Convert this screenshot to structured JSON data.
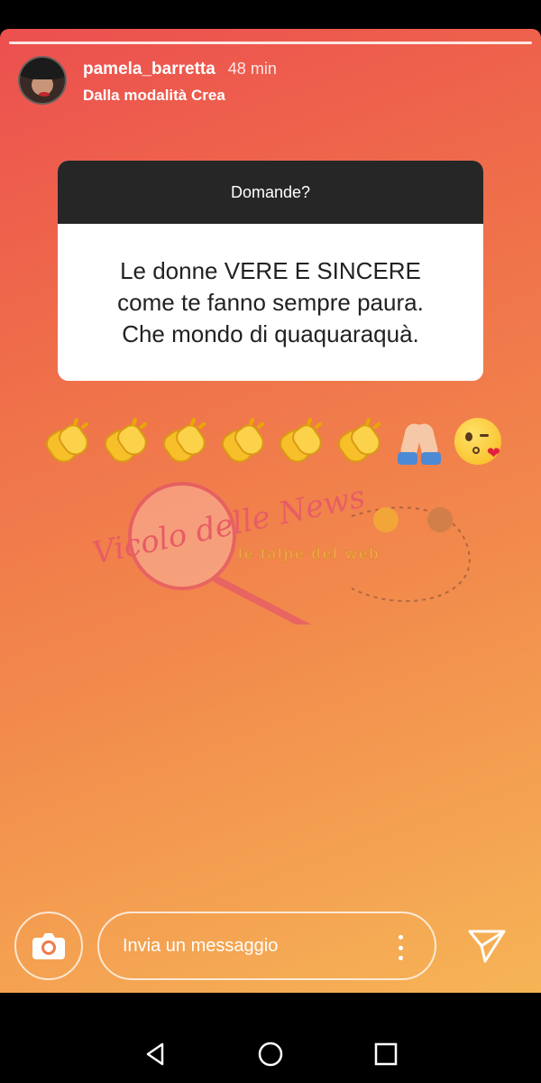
{
  "story": {
    "username": "pamela_barretta",
    "time": "48 min",
    "subtitle": "Dalla modalità Crea",
    "segments": 1
  },
  "question_sticker": {
    "header": "Domande?",
    "answer_lines": [
      "Le donne VERE E SINCERE",
      "come te fanno sempre paura.",
      "Che mondo di quaquaraquà."
    ]
  },
  "emoji_row": [
    "clapping-hands",
    "clapping-hands",
    "clapping-hands",
    "clapping-hands",
    "clapping-hands",
    "clapping-hands",
    "folded-hands",
    "face-blowing-kiss"
  ],
  "watermark": {
    "logo_text": "Vicolo delle News",
    "secondary_text": "le talpe del web"
  },
  "reply": {
    "placeholder": "Invia un messaggio"
  },
  "colors": {
    "gradient_top": "#ec4f4f",
    "gradient_bottom": "#f6b456",
    "sticker_header": "#262626"
  },
  "system_nav": [
    "back-icon",
    "home-icon",
    "recents-icon"
  ]
}
